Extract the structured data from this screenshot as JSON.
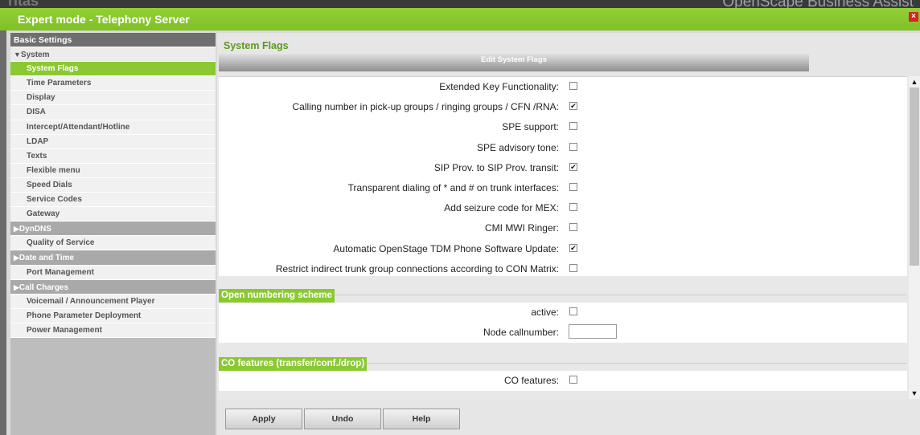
{
  "window": {
    "title": "Expert mode - Telephony Server",
    "background_title": "OpenScape Business Assist",
    "background_logo": "ritas",
    "close_glyph": "×"
  },
  "sidebar": {
    "items": [
      {
        "label": "Basic Settings",
        "kind": "header"
      },
      {
        "label": "System",
        "kind": "group",
        "expanded": true,
        "glyph": "▼"
      },
      {
        "label": "System Flags",
        "kind": "lvl1",
        "active": true
      },
      {
        "label": "Time Parameters",
        "kind": "lvl1"
      },
      {
        "label": "Display",
        "kind": "lvl1"
      },
      {
        "label": "DISA",
        "kind": "lvl1"
      },
      {
        "label": "Intercept/Attendant/Hotline",
        "kind": "lvl1"
      },
      {
        "label": "LDAP",
        "kind": "lvl1"
      },
      {
        "label": "Texts",
        "kind": "lvl1"
      },
      {
        "label": "Flexible menu",
        "kind": "lvl1"
      },
      {
        "label": "Speed Dials",
        "kind": "lvl1"
      },
      {
        "label": "Service Codes",
        "kind": "lvl1"
      },
      {
        "label": "Gateway",
        "kind": "plain"
      },
      {
        "label": "DynDNS",
        "kind": "group-collapsed",
        "glyph": "▶"
      },
      {
        "label": "Quality of Service",
        "kind": "plain"
      },
      {
        "label": "Date and Time",
        "kind": "group-collapsed",
        "glyph": "▶"
      },
      {
        "label": "Port Management",
        "kind": "plain"
      },
      {
        "label": "Call Charges",
        "kind": "group-collapsed",
        "glyph": "▶"
      },
      {
        "label": "Voicemail / Announcement Player",
        "kind": "plain"
      },
      {
        "label": "Phone Parameter Deployment",
        "kind": "plain"
      },
      {
        "label": "Power Management",
        "kind": "plain"
      }
    ]
  },
  "main": {
    "section_title": "System Flags",
    "edit_bar": "Edit System Flags",
    "flags": [
      {
        "label": "Extended Key Functionality:",
        "checked": false
      },
      {
        "label": "Calling number in pick-up groups / ringing groups / CFN /RNA:",
        "checked": true
      },
      {
        "label": "SPE support:",
        "checked": false
      },
      {
        "label": "SPE advisory tone:",
        "checked": false
      },
      {
        "label": "SIP Prov. to SIP Prov. transit:",
        "checked": true
      },
      {
        "label": "Transparent dialing of * and # on trunk interfaces:",
        "checked": false
      },
      {
        "label": "Add seizure code for MEX:",
        "checked": false
      },
      {
        "label": "CMI MWI Ringer:",
        "checked": false
      },
      {
        "label": "Automatic OpenStage TDM Phone Software Update:",
        "checked": true
      },
      {
        "label": "Restrict indirect trunk group connections according to CON Matrix:",
        "checked": false
      }
    ],
    "open_numbering": {
      "header": "Open numbering scheme",
      "active_label": "active:",
      "active_checked": false,
      "node_label": "Node callnumber:",
      "node_value": ""
    },
    "co_features": {
      "header": "CO features (transfer/conf./drop)",
      "label": "CO features:",
      "checked": false
    }
  },
  "buttons": {
    "apply": "Apply",
    "undo": "Undo",
    "help": "Help"
  },
  "colors": {
    "accent_green": "#8bc832",
    "title_green": "#5d9a1a"
  }
}
